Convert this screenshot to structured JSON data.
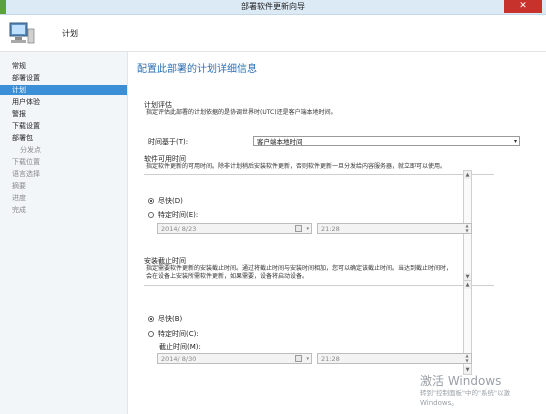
{
  "window": {
    "title": "部署软件更新向导",
    "close_glyph": "✕"
  },
  "header": {
    "step_title": "计划",
    "icon": "computer-wizard-icon"
  },
  "sidebar": {
    "items": [
      {
        "label": "常规",
        "state": "done"
      },
      {
        "label": "部署设置",
        "state": "done"
      },
      {
        "label": "计划",
        "state": "selected"
      },
      {
        "label": "用户体验",
        "state": "done"
      },
      {
        "label": "警报",
        "state": "done"
      },
      {
        "label": "下载设置",
        "state": "done"
      },
      {
        "label": "部署包",
        "state": "done"
      },
      {
        "label": "分发点",
        "state": "inactive",
        "sub": true
      },
      {
        "label": "下载位置",
        "state": "inactive"
      },
      {
        "label": "语言选择",
        "state": "inactive"
      },
      {
        "label": "摘要",
        "state": "inactive"
      },
      {
        "label": "进度",
        "state": "inactive"
      },
      {
        "label": "完成",
        "state": "inactive"
      }
    ]
  },
  "main": {
    "heading": "配置此部署的计划详细信息",
    "evaluation": {
      "title": "计划评估",
      "desc": "指定评估此部署的计划依据的是协调世界时(UTC)还是客户端本地时间。",
      "time_based_label": "时间基于(T):",
      "time_based_value": "客户端本地时间"
    },
    "available": {
      "title": "软件可用时间",
      "desc": "指定软件更新的可用时间。除非计划稍后安装软件更新，否则软件更新一旦分发给内容服务器，就立即可以使用。",
      "opt_asap": "尽快(D)",
      "opt_specific": "特定时间(E):",
      "date": "2014/ 8/23",
      "time": "21:28"
    },
    "deadline": {
      "title": "安装截止时间",
      "desc_line1": "指定需要软件更新的安装截止时间。通过将截止时间与安装时间相加，您可以确定该截止时间。当达到截止时间时，",
      "desc_line2": "会在设备上安装所需软件更新，如果需要，设备将启动设备。",
      "opt_asap": "尽快(B)",
      "opt_specific": "特定时间(C):",
      "deadline_label": "截止时间(M):",
      "date": "2014/ 8/30",
      "time": "21:28"
    }
  },
  "watermark": {
    "line1": "激活 Windows",
    "line2": "转到\"控制面板\"中的\"系统\"以激",
    "line3": "Windows。"
  }
}
